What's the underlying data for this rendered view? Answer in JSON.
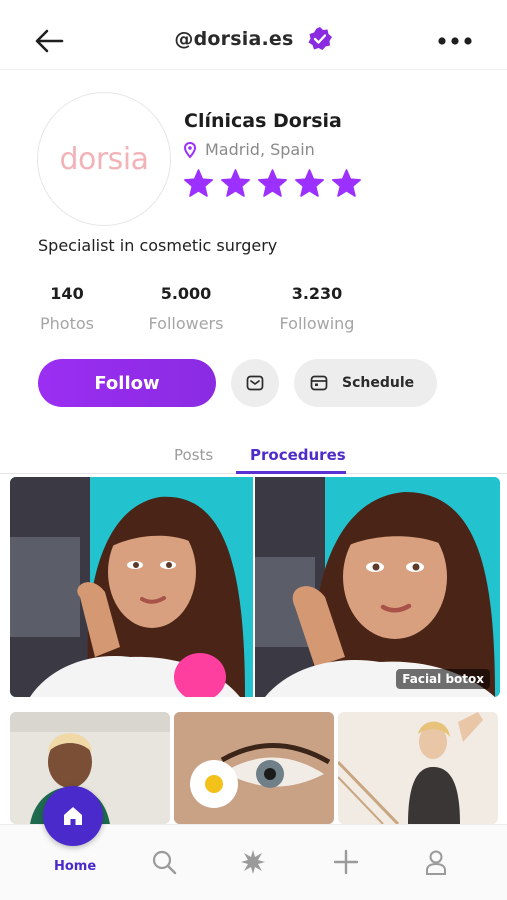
{
  "header": {
    "back_icon": "arrow-left-icon",
    "handle": "@dorsia.es",
    "verified_icon": "verified-badge-icon",
    "more_icon": "more-dots-icon"
  },
  "profile": {
    "avatar_text": "dorsia",
    "name": "Clínicas Dorsia",
    "location": "Madrid, Spain",
    "rating": 5,
    "bio": "Specialist in cosmetic surgery"
  },
  "stats": [
    {
      "value": "140",
      "label": "Photos"
    },
    {
      "value": "5.000",
      "label": "Followers"
    },
    {
      "value": "3.230",
      "label": "Following"
    }
  ],
  "actions": {
    "follow_label": "Follow",
    "message_icon": "message-icon",
    "schedule_label": "Schedule",
    "schedule_icon": "calendar-icon"
  },
  "tabs": [
    {
      "label": "Posts",
      "active": false
    },
    {
      "label": "Procedures",
      "active": true
    }
  ],
  "gallery": {
    "featured_caption": "Facial botox"
  },
  "bottom_nav": [
    {
      "label": "Home",
      "icon": "home-icon",
      "active": true
    },
    {
      "label": "",
      "icon": "search-icon"
    },
    {
      "label": "",
      "icon": "sparkle-icon"
    },
    {
      "label": "",
      "icon": "plus-icon"
    },
    {
      "label": "",
      "icon": "user-icon"
    }
  ],
  "colors": {
    "accent": "#8a2be2",
    "nav_accent": "#4b2acb",
    "star": "#9b30ff"
  }
}
